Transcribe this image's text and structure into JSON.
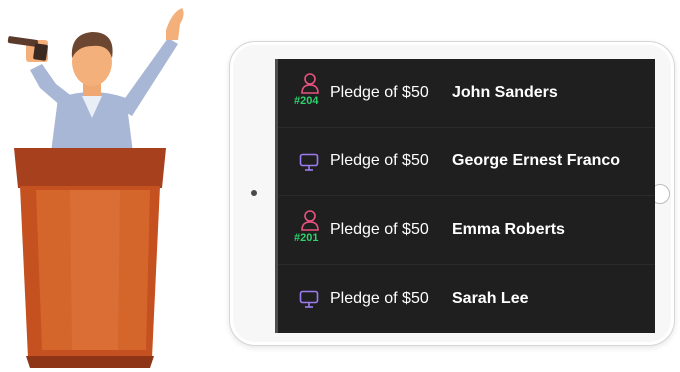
{
  "colors": {
    "screen_bg": "#1f1f1f",
    "person_icon": "#e8537f",
    "monitor_icon": "#9b7cf0",
    "number_badge": "#2ed16b",
    "text": "#ffffff"
  },
  "pledges": [
    {
      "icon": "person-icon",
      "number": "#204",
      "pledge_text": "Pledge of $50",
      "donor": "John Sanders"
    },
    {
      "icon": "monitor-icon",
      "number": "",
      "pledge_text": "Pledge of $50",
      "donor": "George Ernest Franco"
    },
    {
      "icon": "person-icon",
      "number": "#201",
      "pledge_text": "Pledge of $50",
      "donor": "Emma Roberts"
    },
    {
      "icon": "monitor-icon",
      "number": "",
      "pledge_text": "Pledge of $50",
      "donor": "Sarah Lee"
    }
  ]
}
